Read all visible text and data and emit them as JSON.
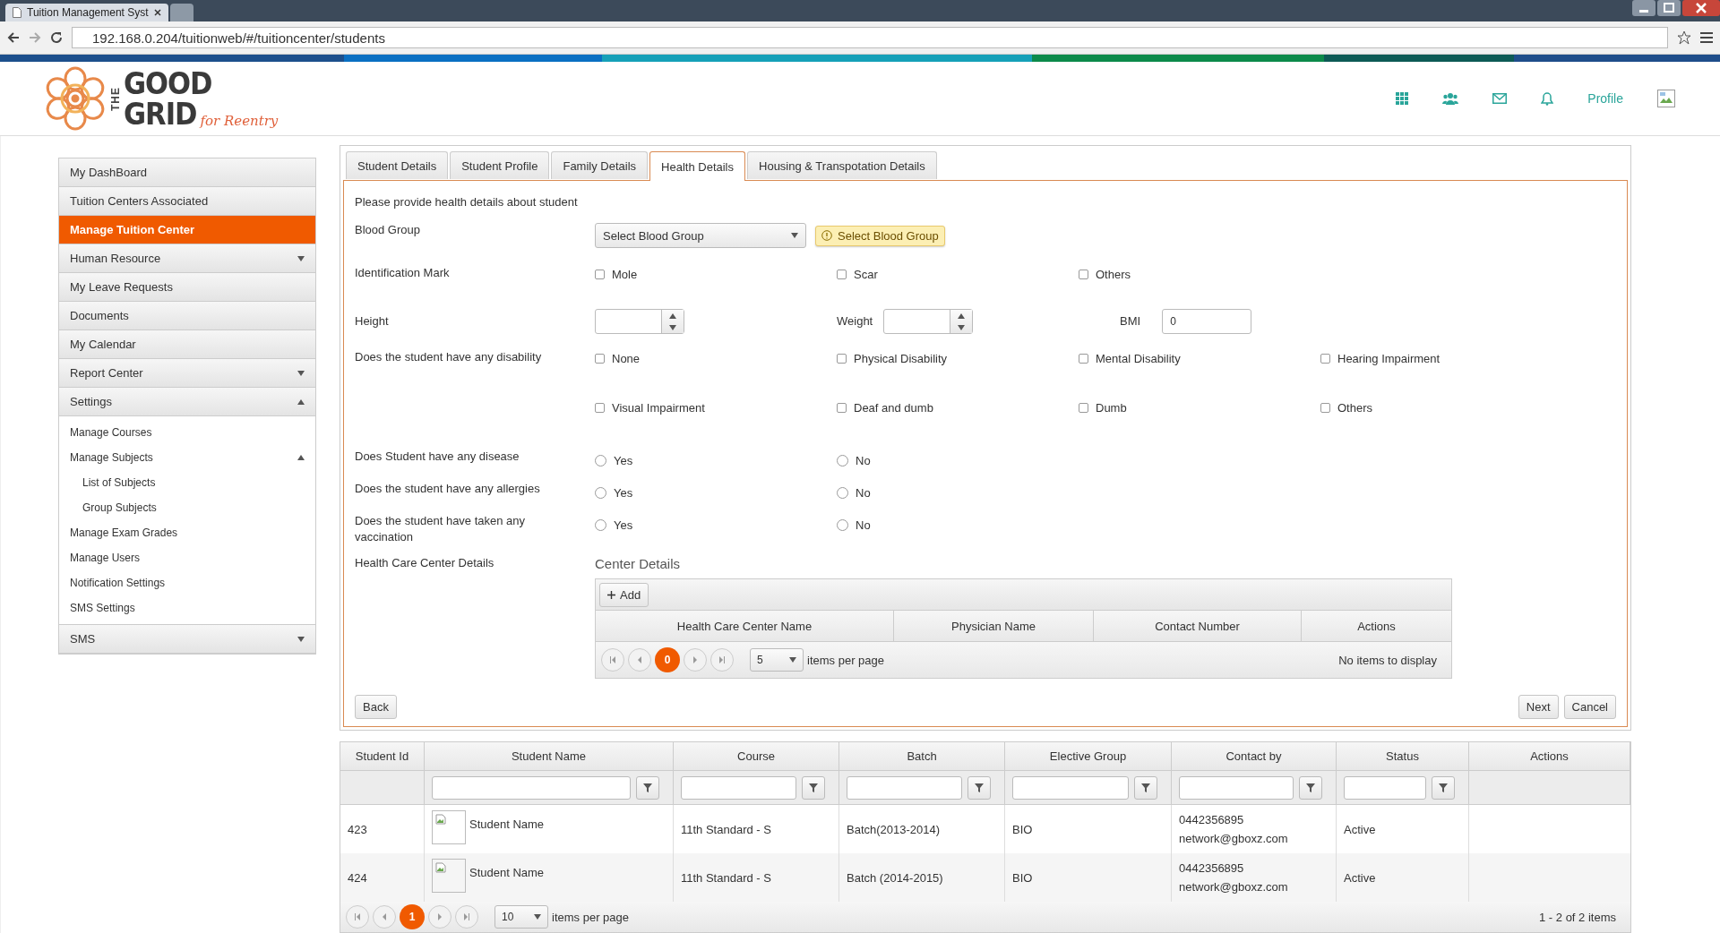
{
  "browser": {
    "tabs": [
      {
        "title": "Tuition Management Syst",
        "selected": true
      },
      {
        "selected": false
      }
    ],
    "url": "192.168.0.204/tuitionweb/#/tuitioncenter/students"
  },
  "header": {
    "logo": {
      "word_vertical": "THE",
      "word_top": "GOOD",
      "word_bottom": "GRID",
      "tagline": "for Reentry"
    },
    "profile": "Profile"
  },
  "sidebar": {
    "items": [
      {
        "label": "My DashBoard",
        "kind": "link",
        "selected": false
      },
      {
        "label": "Tuition Centers Associated",
        "kind": "link",
        "selected": false
      },
      {
        "label": "Manage Tuition Center",
        "kind": "link",
        "selected": true
      },
      {
        "label": "Human Resource",
        "kind": "group",
        "selected": false,
        "expanded": false
      },
      {
        "label": "My Leave Requests",
        "kind": "link",
        "selected": false
      },
      {
        "label": "Documents",
        "kind": "link",
        "selected": false
      },
      {
        "label": "My Calendar",
        "kind": "link",
        "selected": false
      },
      {
        "label": "Report Center",
        "kind": "group",
        "selected": false,
        "expanded": false
      },
      {
        "label": "Settings",
        "kind": "group",
        "selected": false,
        "expanded": true,
        "children": [
          {
            "label": "Manage Courses",
            "kind": "link"
          },
          {
            "label": "Manage Subjects",
            "kind": "group",
            "expanded": true,
            "children": [
              {
                "label": "List of Subjects"
              },
              {
                "label": "Group Subjects"
              }
            ]
          },
          {
            "label": "Manage Exam Grades",
            "kind": "link"
          },
          {
            "label": "Manage Users",
            "kind": "link"
          },
          {
            "label": "Notification Settings",
            "kind": "link"
          },
          {
            "label": "SMS Settings",
            "kind": "link"
          }
        ]
      },
      {
        "label": "SMS",
        "kind": "group",
        "selected": false,
        "expanded": false
      }
    ]
  },
  "form": {
    "tabs": [
      {
        "label": "Student Details",
        "selected": false
      },
      {
        "label": "Student Profile",
        "selected": false
      },
      {
        "label": "Family Details",
        "selected": false
      },
      {
        "label": "Health Details",
        "selected": true
      },
      {
        "label": "Housing & Transpotation Details",
        "selected": false
      }
    ],
    "intro": "Please provide health details about student",
    "blood_group": {
      "label": "Blood Group",
      "placeholder": "Select Blood Group",
      "validation": "Select Blood Group"
    },
    "identification": {
      "label": "Identification Mark",
      "options": [
        {
          "label": "Mole",
          "checked": false
        },
        {
          "label": "Scar",
          "checked": false
        },
        {
          "label": "Others",
          "checked": false
        }
      ]
    },
    "height": {
      "label": "Height"
    },
    "weight": {
      "label": "Weight"
    },
    "bmi": {
      "label": "BMI",
      "value": "0"
    },
    "disability": {
      "label": "Does the student have any disability",
      "options": [
        {
          "label": "None",
          "checked": false
        },
        {
          "label": "Physical Disability",
          "checked": false
        },
        {
          "label": "Mental Disability",
          "checked": false
        },
        {
          "label": "Hearing Impairment",
          "checked": false
        },
        {
          "label": "Visual Impairment",
          "checked": false
        },
        {
          "label": "Deaf and dumb",
          "checked": false
        },
        {
          "label": "Dumb",
          "checked": false
        },
        {
          "label": "Others",
          "checked": false
        }
      ]
    },
    "questions": [
      {
        "label": "Does Student have any disease",
        "options": [
          {
            "label": "Yes",
            "selected": false
          },
          {
            "label": "No",
            "selected": false
          }
        ]
      },
      {
        "label": "Does the student have any allergies",
        "options": [
          {
            "label": "Yes",
            "selected": false
          },
          {
            "label": "No",
            "selected": false
          }
        ]
      },
      {
        "label": "Does the student have taken any vaccination",
        "options": [
          {
            "label": "Yes",
            "selected": false
          },
          {
            "label": "No",
            "selected": false
          }
        ]
      }
    ],
    "health_care": {
      "label": "Health Care Center Details",
      "title": "Center Details",
      "add": "Add",
      "columns": [
        "Health Care Center Name",
        "Physician Name",
        "Contact Number",
        "Actions"
      ],
      "pager": {
        "page": "0",
        "page_size": "5",
        "per_page": "items per page",
        "status": "No items to display"
      }
    },
    "buttons": {
      "back": "Back",
      "next": "Next",
      "cancel": "Cancel"
    }
  },
  "students": {
    "columns": [
      {
        "label": "Student Id",
        "filter": false
      },
      {
        "label": "Student Name",
        "filter": true
      },
      {
        "label": "Course",
        "filter": true
      },
      {
        "label": "Batch",
        "filter": true
      },
      {
        "label": "Elective Group",
        "filter": true
      },
      {
        "label": "Contact  by",
        "filter": true
      },
      {
        "label": "Status",
        "filter": true
      },
      {
        "label": "Actions",
        "filter": false
      }
    ],
    "rows": [
      {
        "id": "423",
        "name": "Student Name",
        "course": "11th Standard - S",
        "batch": "Batch(2013-2014)",
        "elective": "BIO",
        "phone": "0442356895",
        "email": "network@gboxz.com",
        "status": "Active"
      },
      {
        "id": "424",
        "name": "Student Name",
        "course": "11th Standard - S",
        "batch": "Batch (2014-2015)",
        "elective": "BIO",
        "phone": "0442356895",
        "email": "network@gboxz.com",
        "status": "Active"
      }
    ],
    "pager": {
      "page": "1",
      "page_size": "10",
      "per_page": "items per page",
      "status": "1 - 2 of 2 items"
    }
  }
}
